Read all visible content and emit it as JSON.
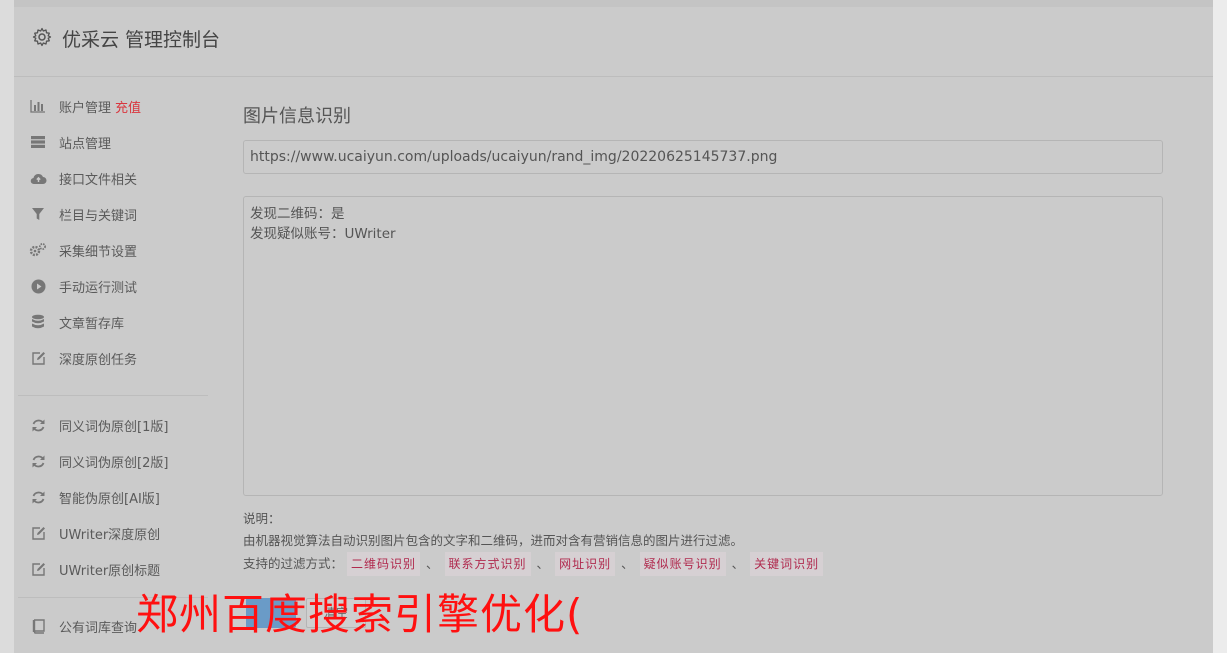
{
  "header": {
    "icon": "gear-icon",
    "title": "优采云 管理控制台"
  },
  "sidebar": {
    "group1": [
      {
        "label": "账户管理",
        "extra": "充值",
        "icon": "bar-chart-icon"
      },
      {
        "label": "站点管理",
        "icon": "server-icon"
      },
      {
        "label": "接口文件相关",
        "icon": "cloud-upload-icon"
      },
      {
        "label": "栏目与关键词",
        "icon": "filter-icon"
      },
      {
        "label": "采集细节设置",
        "icon": "gears-icon"
      },
      {
        "label": "手动运行测试",
        "icon": "play-circle-icon"
      },
      {
        "label": "文章暂存库",
        "icon": "database-icon"
      },
      {
        "label": "深度原创任务",
        "icon": "edit-icon"
      }
    ],
    "group2": [
      {
        "label": "同义词伪原创[1版]",
        "icon": "refresh-icon"
      },
      {
        "label": "同义词伪原创[2版]",
        "icon": "refresh-icon"
      },
      {
        "label": "智能伪原创[AI版]",
        "icon": "refresh-icon"
      },
      {
        "label": "UWriter深度原创",
        "icon": "edit-icon"
      },
      {
        "label": "UWriter原创标题",
        "icon": "edit-icon"
      }
    ],
    "group3": [
      {
        "label": "公有词库查询",
        "icon": "book-icon"
      }
    ]
  },
  "main": {
    "title": "图片信息识别",
    "url_value": "https://www.ucaiyun.com/uploads/ucaiyun/rand_img/20220625145737.png",
    "result_lines": [
      "发现二维码：是",
      "发现疑似账号：UWriter"
    ],
    "notes": {
      "heading": "说明：",
      "description": "由机器视觉算法自动识别图片包含的文字和二维码，进而对含有营销信息的图片进行过滤。",
      "filter_label": "支持的过滤方式：",
      "filters": [
        "二维码识别",
        "联系方式识别",
        "网址识别",
        "疑似账号识别",
        "关键词识别"
      ],
      "separator": "、"
    },
    "buttons": {
      "secondary_label": "清空"
    }
  },
  "watermark": "郑州百度搜索引擎优化("
}
